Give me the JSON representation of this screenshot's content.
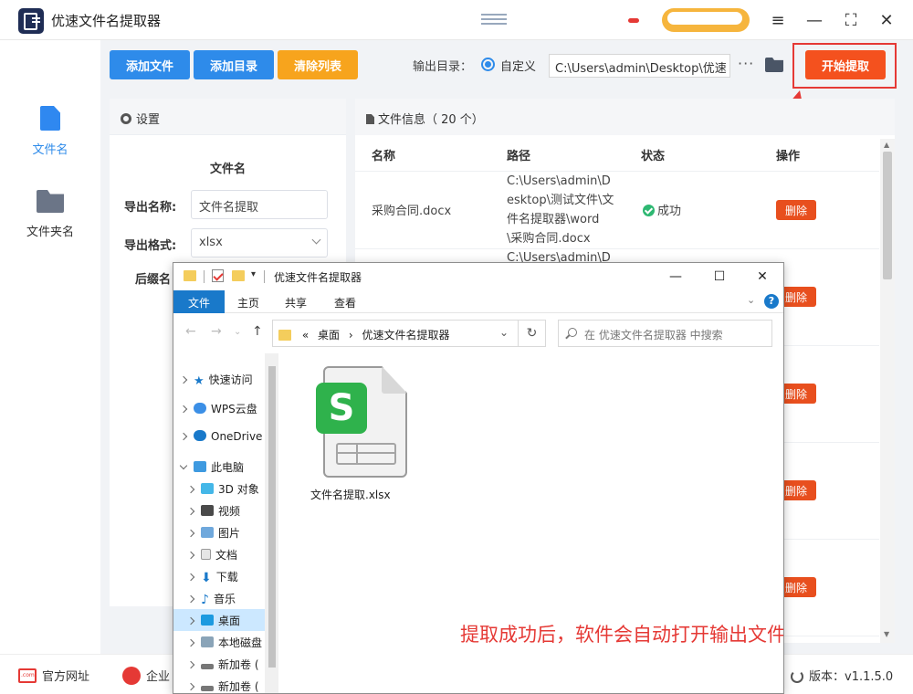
{
  "app": {
    "title": "优速文件名提取器"
  },
  "sidebar": {
    "items": [
      {
        "label": "文件名"
      },
      {
        "label": "文件夹名"
      }
    ]
  },
  "toolbar": {
    "add_file": "添加文件",
    "add_dir": "添加目录",
    "clear_list": "清除列表",
    "output_dir_label": "输出目录：",
    "custom_label": "自定义",
    "output_path": "C:\\Users\\admin\\Desktop\\优速",
    "more": "···",
    "start": "开始提取"
  },
  "settings": {
    "title": "设置",
    "section": "文件名",
    "export_name_label": "导出名称:",
    "export_name_value": "文件名提取",
    "export_format_label": "导出格式:",
    "export_format_value": "xlsx",
    "suffix_label": "后缀名"
  },
  "file_info": {
    "title": "文件信息（ 20 个）",
    "columns": [
      "名称",
      "路径",
      "状态",
      "操作"
    ],
    "rows": [
      {
        "name": "采购合同.docx",
        "path": "C:\\Users\\admin\\Desktop\\测试文件\\文件名提取器\\word\\采购合同.docx",
        "status": "成功",
        "action": "删除"
      },
      {
        "path": "C:\\Users\\admin\\D",
        "action": "删除"
      },
      {
        "action": "删除"
      },
      {
        "action": "删除"
      },
      {
        "action": "删除"
      }
    ]
  },
  "footer": {
    "website": "官方网址",
    "enterprise": "企业",
    "version": "版本：v1.1.5.0"
  },
  "explorer": {
    "title": "优速文件名提取器",
    "ribbon": [
      "文件",
      "主页",
      "共享",
      "查看"
    ],
    "help": "?",
    "address": [
      "«",
      "桌面",
      "›",
      "优速文件名提取器"
    ],
    "refresh": "↻",
    "search_placeholder": "在 优速文件名提取器 中搜索",
    "tree": [
      {
        "label": "快速访问"
      },
      {
        "label": "WPS云盘"
      },
      {
        "label": "OneDrive"
      },
      {
        "label": "此电脑"
      },
      {
        "label": "3D 对象"
      },
      {
        "label": "视频"
      },
      {
        "label": "图片"
      },
      {
        "label": "文档"
      },
      {
        "label": "下载"
      },
      {
        "label": "音乐"
      },
      {
        "label": "桌面"
      },
      {
        "label": "本地磁盘"
      },
      {
        "label": "新加卷 ("
      },
      {
        "label": "新加卷 ("
      }
    ],
    "file": {
      "name": "文件名提取.xlsx",
      "badge": "S"
    }
  },
  "annotation": "提取成功后，软件会自动打开输出文件夹",
  "colors": {
    "primary": "#2e8bea",
    "orange": "#f7a41d",
    "start": "#f4511e",
    "delete": "#e84f1e",
    "annotation": "#e53935",
    "success": "#2eb872"
  }
}
